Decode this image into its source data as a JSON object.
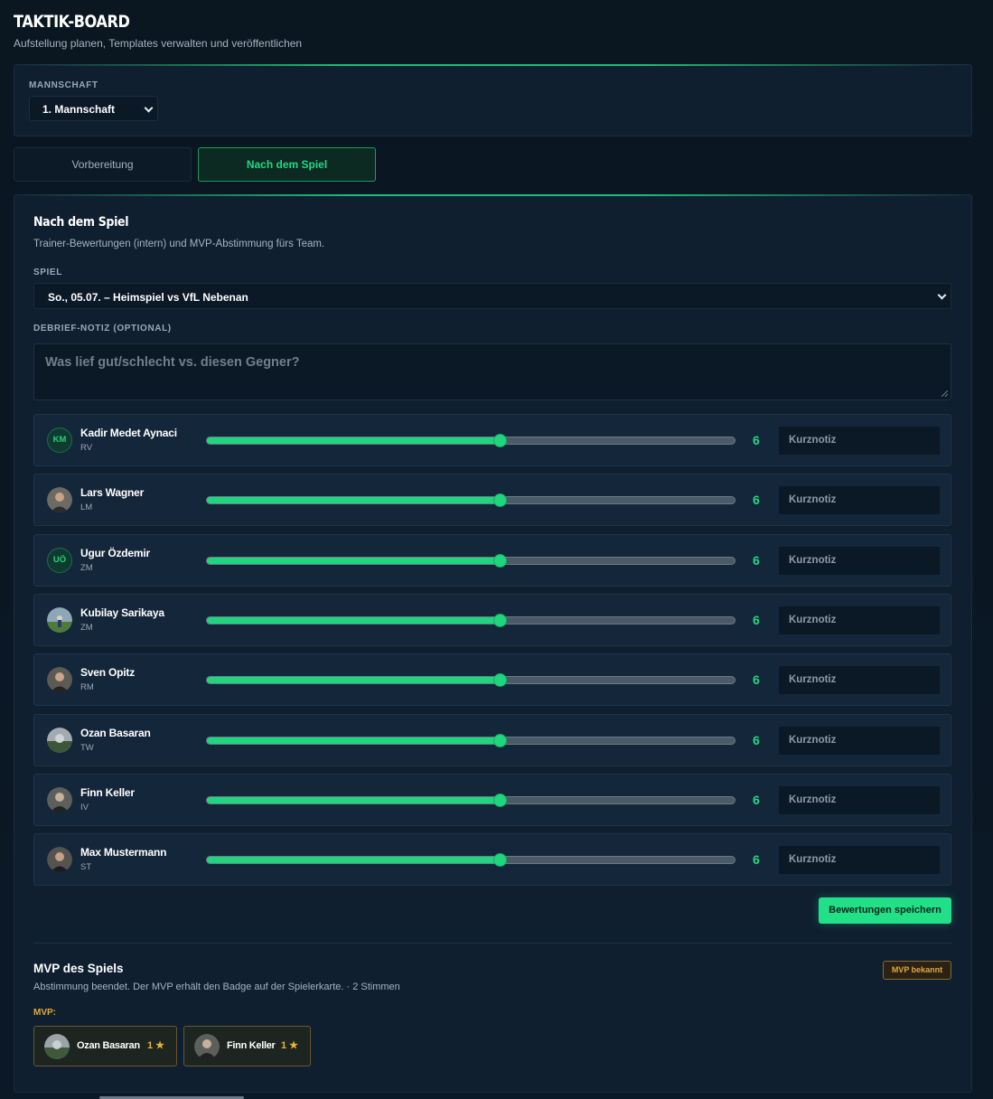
{
  "header": {
    "title": "TAKTIK-BOARD",
    "subtitle": "Aufstellung planen, Templates verwalten und veröffentlichen"
  },
  "team": {
    "label": "MANNSCHAFT",
    "selected": "1. Mannschaft"
  },
  "tabs": [
    {
      "label": "Vorbereitung",
      "active": false
    },
    {
      "label": "Nach dem Spiel",
      "active": true
    }
  ],
  "post_game": {
    "title": "Nach dem Spiel",
    "subtitle": "Trainer-Bewertungen (intern) und MVP-Abstimmung fürs Team.",
    "game_label": "SPIEL",
    "game_selected": "So., 05.07. – Heimspiel vs VfL Nebenan",
    "note_label": "DEBRIEF-NOTIZ (OPTIONAL)",
    "note_placeholder": "Was lief gut/schlecht vs. diesen Gegner?",
    "rating_scale": {
      "min": 1,
      "max": 10
    },
    "players": [
      {
        "initials": "KM",
        "name": "Kadir Medet Aynaci",
        "position": "RV",
        "rating": 6,
        "note_placeholder": "Kurznotiz",
        "avatar": "initials"
      },
      {
        "initials": "",
        "name": "Lars Wagner",
        "position": "LM",
        "rating": 6,
        "note_placeholder": "Kurznotiz",
        "avatar": "photo"
      },
      {
        "initials": "UÖ",
        "name": "Ugur Özdemir",
        "position": "ZM",
        "rating": 6,
        "note_placeholder": "Kurznotiz",
        "avatar": "initials"
      },
      {
        "initials": "",
        "name": "Kubilay Sarikaya",
        "position": "ZM",
        "rating": 6,
        "note_placeholder": "Kurznotiz",
        "avatar": "photo"
      },
      {
        "initials": "",
        "name": "Sven Opitz",
        "position": "RM",
        "rating": 6,
        "note_placeholder": "Kurznotiz",
        "avatar": "photo"
      },
      {
        "initials": "",
        "name": "Ozan Basaran",
        "position": "TW",
        "rating": 6,
        "note_placeholder": "Kurznotiz",
        "avatar": "photo"
      },
      {
        "initials": "",
        "name": "Finn Keller",
        "position": "IV",
        "rating": 6,
        "note_placeholder": "Kurznotiz",
        "avatar": "photo"
      },
      {
        "initials": "",
        "name": "Max Mustermann",
        "position": "ST",
        "rating": 6,
        "note_placeholder": "Kurznotiz",
        "avatar": "photo"
      }
    ],
    "save_label": "Bewertungen speichern"
  },
  "mvp": {
    "title": "MVP des Spiels",
    "badge": "MVP bekannt",
    "subtitle": "Abstimmung beendet. Der MVP erhält den Badge auf der Spielerkarte. · 2 Stimmen",
    "label": "MVP:",
    "winners": [
      {
        "name": "Ozan Basaran",
        "votes": "1 ★"
      },
      {
        "name": "Finn Keller",
        "votes": "1 ★"
      }
    ]
  },
  "colors": {
    "accent": "#22e088",
    "gold": "#e3a83a",
    "background": "#0b1724",
    "card": "#0f1f30"
  },
  "icons": {
    "select": "chevron-down-icon",
    "star": "star-icon"
  }
}
